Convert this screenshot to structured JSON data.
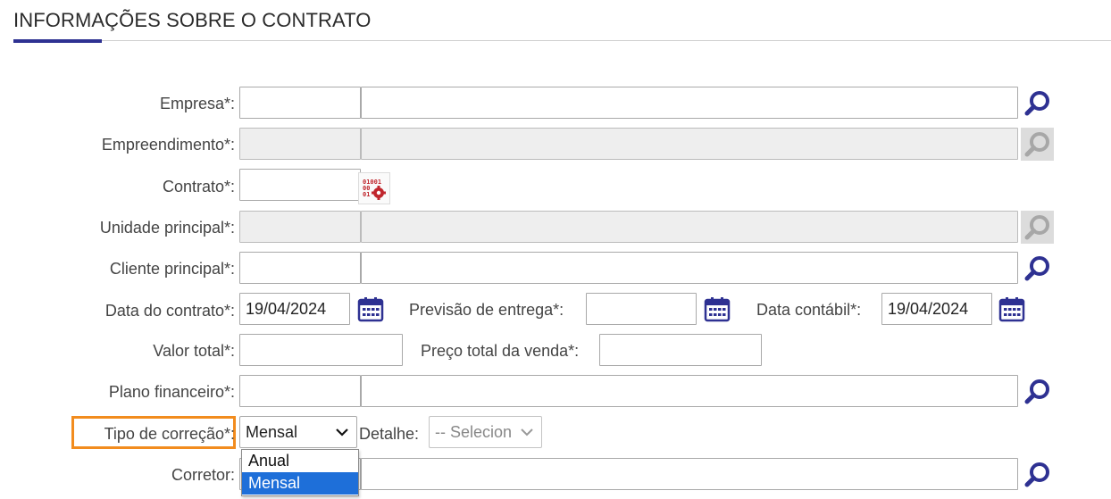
{
  "section": {
    "title": "INFORMAÇÕES SOBRE O CONTRATO"
  },
  "form": {
    "empresa": {
      "label": "Empresa*:",
      "code": "",
      "name": ""
    },
    "empreendimento": {
      "label": "Empreendimento*:",
      "code": "",
      "name": ""
    },
    "contrato": {
      "label": "Contrato*:",
      "value": ""
    },
    "unidade": {
      "label": "Unidade principal*:",
      "code": "",
      "name": ""
    },
    "cliente": {
      "label": "Cliente principal*:",
      "code": "",
      "name": ""
    },
    "data_contrato": {
      "label": "Data do contrato*:",
      "value": "19/04/2024"
    },
    "previsao_entrega": {
      "label": "Previsão de entrega*:",
      "value": ""
    },
    "data_contabil": {
      "label": "Data contábil*:",
      "value": "19/04/2024"
    },
    "valor_total": {
      "label": "Valor total*:",
      "value": ""
    },
    "preco_total": {
      "label": "Preço total da venda*:",
      "value": ""
    },
    "plano_financeiro": {
      "label": "Plano financeiro*:",
      "code": "",
      "name": ""
    },
    "tipo_correcao": {
      "label": "Tipo de correção*:",
      "selected": "Mensal",
      "options": [
        "Anual",
        "Mensal"
      ]
    },
    "detalhe": {
      "label": "Detalhe:",
      "selected": "-- Selecion"
    },
    "corretor": {
      "label": "Corretor:",
      "code": "",
      "name": ""
    }
  },
  "colors": {
    "accent": "#2e3192",
    "highlight": "#f28c1e",
    "selected_option": "#1e6fd9",
    "icon": "#2e3192"
  },
  "icons": [
    "search-icon",
    "code-generator-icon",
    "calendar-icon",
    "chevron-down-icon"
  ]
}
